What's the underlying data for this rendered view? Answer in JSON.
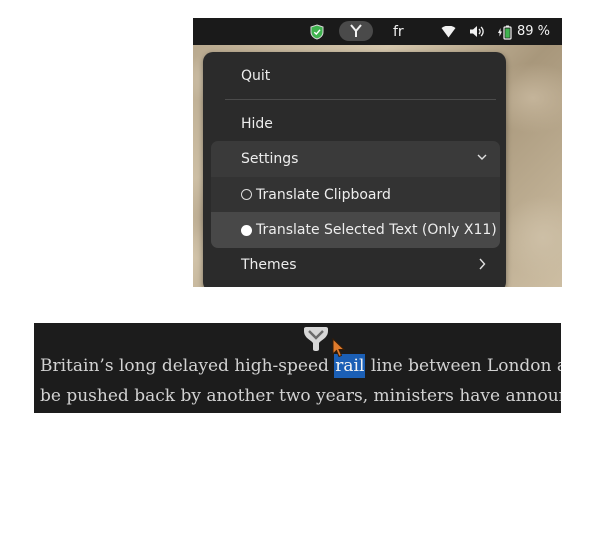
{
  "tray": {
    "language": "fr",
    "battery": "89 %",
    "icons": [
      "shield-icon",
      "app-indicator-icon",
      "wifi-icon",
      "volume-icon",
      "battery-icon"
    ]
  },
  "menu": {
    "quit": "Quit",
    "hide": "Hide",
    "settings": "Settings",
    "translate_clipboard": "Translate Clipboard",
    "translate_selected": "Translate Selected Text (Only X11)",
    "themes": "Themes"
  },
  "article": {
    "line1_before": "Britain’s long delayed high-speed ",
    "line1_selected": "rail",
    "line1_after": " line between London and",
    "line2": "be pushed back by another two years, ministers have announced"
  },
  "colors": {
    "selection": "#1b5fb5",
    "menu_bg": "#2b2b2b",
    "topbar_bg": "#1a1a1a",
    "shield": "#3fb34f",
    "battery_fill": "#3fb34f",
    "cursor": "#e07b2c"
  }
}
